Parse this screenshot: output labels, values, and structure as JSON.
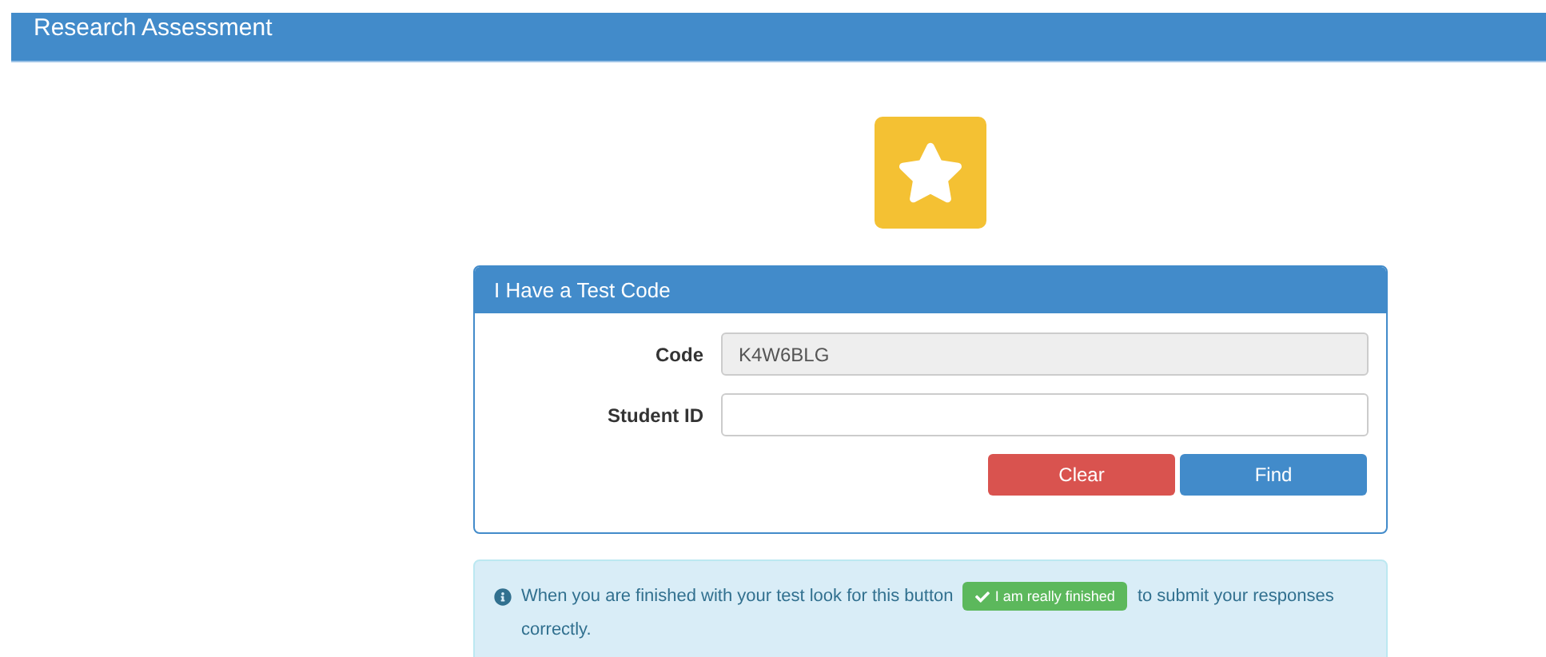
{
  "header": {
    "title": "Research Assessment"
  },
  "panel": {
    "title": "I Have a Test Code",
    "fields": [
      {
        "label": "Code",
        "value": "K4W6BLG",
        "disabled": true
      },
      {
        "label": "Student ID",
        "disabled": false
      }
    ],
    "buttons": [
      {
        "label": "Clear",
        "kind": "danger"
      },
      {
        "label": "Find",
        "kind": "primary"
      }
    ]
  },
  "info": {
    "before": "When you are finished with your test look for this button",
    "button": "I am really finished",
    "after": "to submit your responses correctly."
  }
}
